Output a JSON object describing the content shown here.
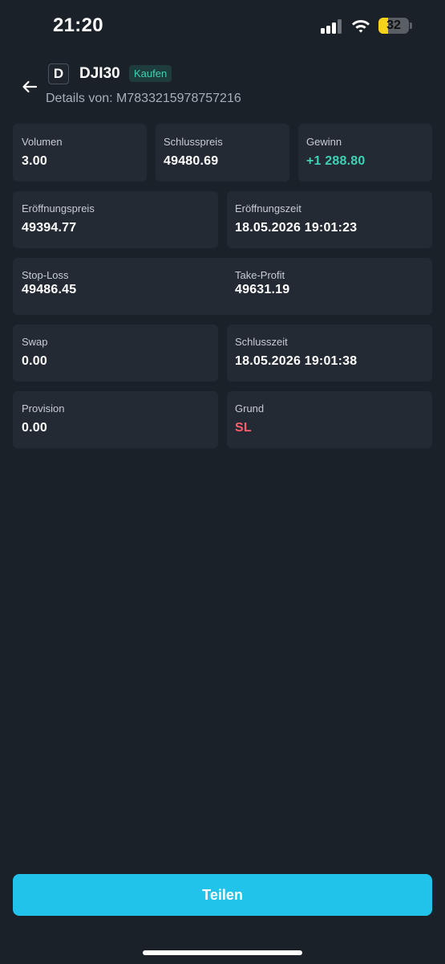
{
  "status_bar": {
    "time": "21:20",
    "battery_percent": "32",
    "battery_level": 0.32,
    "signal_bars_active": 3,
    "signal_bars_total": 4
  },
  "header": {
    "symbol_icon_letter": "D",
    "symbol": "DJI30",
    "side_badge": "Kaufen",
    "details_label": "Details von: M7833215978757216"
  },
  "fields": {
    "volume": {
      "label": "Volumen",
      "value": "3.00"
    },
    "close_price": {
      "label": "Schlusspreis",
      "value": "49480.69"
    },
    "profit": {
      "label": "Gewinn",
      "value": "+1 288.80"
    },
    "open_price": {
      "label": "Eröffnungspreis",
      "value": "49394.77"
    },
    "open_time": {
      "label": "Eröffnungszeit",
      "value": "18.05.2026 19:01:23"
    },
    "stop_loss": {
      "label": "Stop-Loss",
      "value": "49486.45"
    },
    "take_profit": {
      "label": "Take-Profit",
      "value": "49631.19"
    },
    "swap": {
      "label": "Swap",
      "value": "0.00"
    },
    "close_time": {
      "label": "Schlusszeit",
      "value": "18.05.2026 19:01:38"
    },
    "commission": {
      "label": "Provision",
      "value": "0.00"
    },
    "reason": {
      "label": "Grund",
      "value": "SL"
    }
  },
  "actions": {
    "share_label": "Teilen"
  },
  "colors": {
    "background": "#1b2129",
    "card": "#232a33",
    "accent": "#22c3ea",
    "positive": "#3fd1b5",
    "negative": "#ff5d6c"
  }
}
